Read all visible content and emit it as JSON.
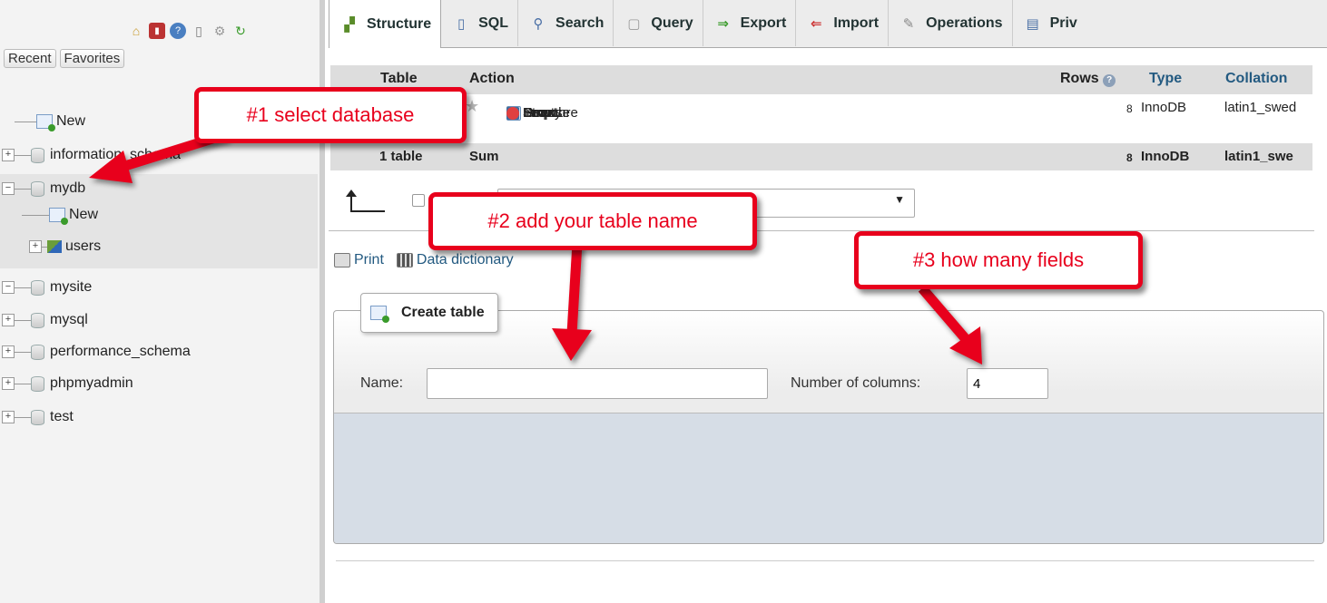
{
  "sidebar": {
    "recent_label": "Recent",
    "favorites_label": "Favorites",
    "tree": {
      "new_label": "New",
      "databases": [
        "information_schema",
        "mydb",
        "mysite",
        "mysql",
        "performance_schema",
        "phpmyadmin",
        "test"
      ],
      "mydb_new_label": "New",
      "mydb_table": "users"
    }
  },
  "tabs": [
    "Structure",
    "SQL",
    "Search",
    "Query",
    "Export",
    "Import",
    "Operations",
    "Priv"
  ],
  "table": {
    "headers": {
      "table": "Table",
      "action": "Action",
      "rows": "Rows",
      "type": "Type",
      "collation": "Collation"
    },
    "actions": [
      "Browse",
      "Structure",
      "Search",
      "Insert",
      "Empty",
      "Drop"
    ],
    "row": {
      "rows": "8",
      "type": "InnoDB",
      "collation": "latin1_swed"
    },
    "summary": {
      "label": "1 table",
      "sum": "Sum",
      "rows": "8",
      "type": "InnoDB",
      "collation": "latin1_swe"
    }
  },
  "links": {
    "print": "Print",
    "data_dictionary": "Data dictionary"
  },
  "create_table": {
    "legend": "Create table",
    "name_label": "Name:",
    "name_value": "",
    "columns_label": "Number of columns:",
    "columns_value": "4"
  },
  "annotations": {
    "step1": "#1 select database",
    "step2": "#2 add your table name",
    "step3": "#3 how many fields"
  },
  "colors": {
    "annotation_red": "#e8001c",
    "link_blue": "#235a81"
  }
}
